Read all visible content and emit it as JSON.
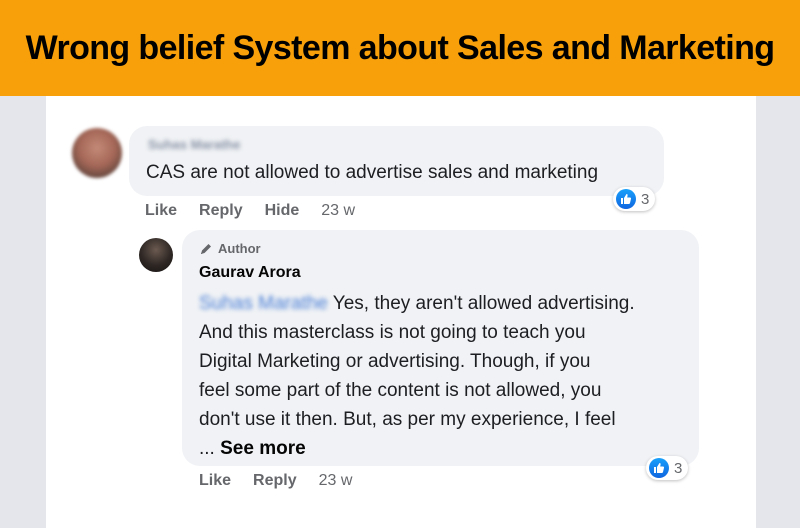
{
  "banner": {
    "title": "Wrong belief System about Sales and Marketing"
  },
  "comment": {
    "author_blurred": "Suhas Marathe",
    "text": "CAS are not allowed to advertise sales and marketing",
    "actions": {
      "like": "Like",
      "reply": "Reply",
      "hide": "Hide"
    },
    "timestamp": "23 w",
    "reaction_count": "3"
  },
  "reply": {
    "badge": "Author",
    "author": "Gaurav Arora",
    "mention_blurred": "Suhas Marathe",
    "lines": [
      "Yes, they aren't allowed advertising.",
      "And this masterclass is not going to teach you",
      "Digital Marketing or advertising. Though, if you",
      "feel some part of the content is not allowed, you",
      "don't use it then. But, as per my experience, I feel"
    ],
    "ellipsis": "... ",
    "see_more": "See more",
    "actions": {
      "like": "Like",
      "reply": "Reply"
    },
    "timestamp": "23 w",
    "reaction_count": "3"
  },
  "colors": {
    "banner": "#f7a00a",
    "bubble": "#f0f2f5",
    "like_blue": "#1877f2",
    "meta_gray": "#65676b"
  }
}
